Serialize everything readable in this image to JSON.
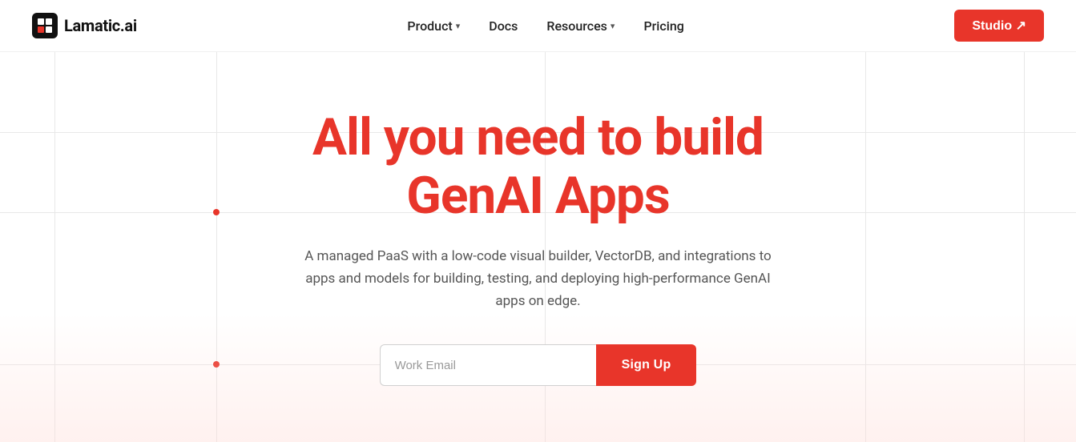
{
  "logo": {
    "text": "Lamatic.ai"
  },
  "navbar": {
    "product_label": "Product",
    "docs_label": "Docs",
    "resources_label": "Resources",
    "pricing_label": "Pricing",
    "studio_label": "Studio ↗"
  },
  "hero": {
    "title_line1": "All you need to build",
    "title_line2": "GenAI Apps",
    "subtitle": "A managed PaaS with a low-code visual builder, VectorDB, and integrations to apps and models for building, testing, and deploying high-performance GenAI apps on edge.",
    "email_placeholder": "Work Email",
    "signup_label": "Sign Up"
  },
  "colors": {
    "brand_red": "#e8352a",
    "nav_text": "#222222",
    "subtitle_text": "#555555"
  }
}
